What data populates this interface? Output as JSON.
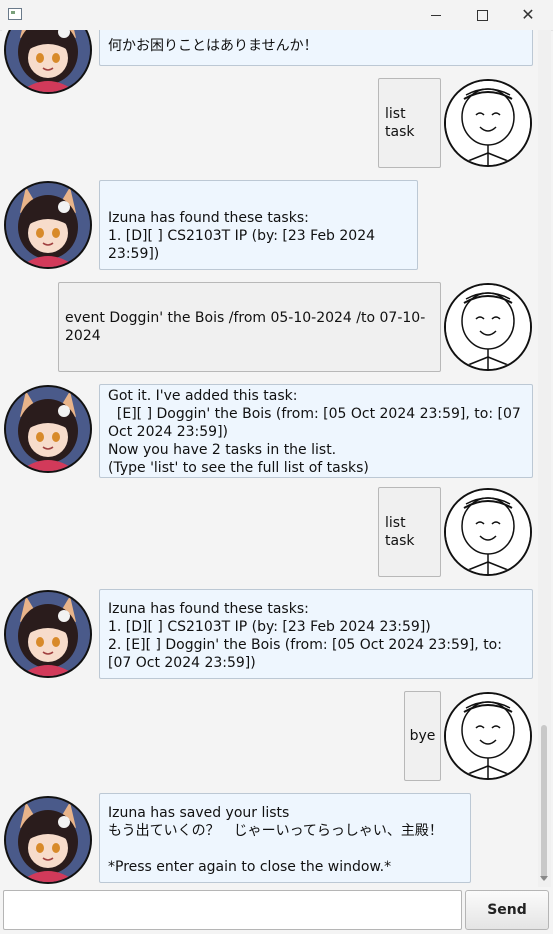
{
  "window": {
    "title": "",
    "minimize_icon": "minimize-icon",
    "maximize_icon": "maximize-icon",
    "close_icon": "close-icon"
  },
  "messages": [
    {
      "sender": "duke",
      "text": "何かお困りことはありませんか！"
    },
    {
      "sender": "user",
      "text": "list task"
    },
    {
      "sender": "duke",
      "text": "Izuna has found these tasks:\n1. [D][ ] CS2103T IP (by: [23 Feb 2024 23:59])"
    },
    {
      "sender": "user",
      "text": "event Doggin' the Bois /from 05-10-2024 /to 07-10-2024"
    },
    {
      "sender": "duke",
      "text": "Got it. I've added this task:\n  [E][ ] Doggin' the Bois (from: [05 Oct 2024 23:59], to: [07 Oct 2024 23:59])\nNow you have 2 tasks in the list.\n(Type 'list' to see the full list of tasks)"
    },
    {
      "sender": "user",
      "text": "list task"
    },
    {
      "sender": "duke",
      "text": "Izuna has found these tasks:\n1. [D][ ] CS2103T IP (by: [23 Feb 2024 23:59])\n2. [E][ ] Doggin' the Bois (from: [05 Oct 2024 23:59], to: [07 Oct 2024 23:59])"
    },
    {
      "sender": "user",
      "text": "bye"
    },
    {
      "sender": "duke",
      "text": "Izuna has saved your lists\nもう出ていくの？　じゃーいってらっしゃい、主殿！\n\n*Press enter again to close the window.*"
    }
  ],
  "input": {
    "value": "",
    "placeholder": ""
  },
  "send_button": {
    "label": "Send"
  },
  "colors": {
    "duke_bubble_bg": "#eef6fe",
    "user_bubble_bg": "#f0f0f0",
    "window_bg": "#f4f4f4"
  }
}
